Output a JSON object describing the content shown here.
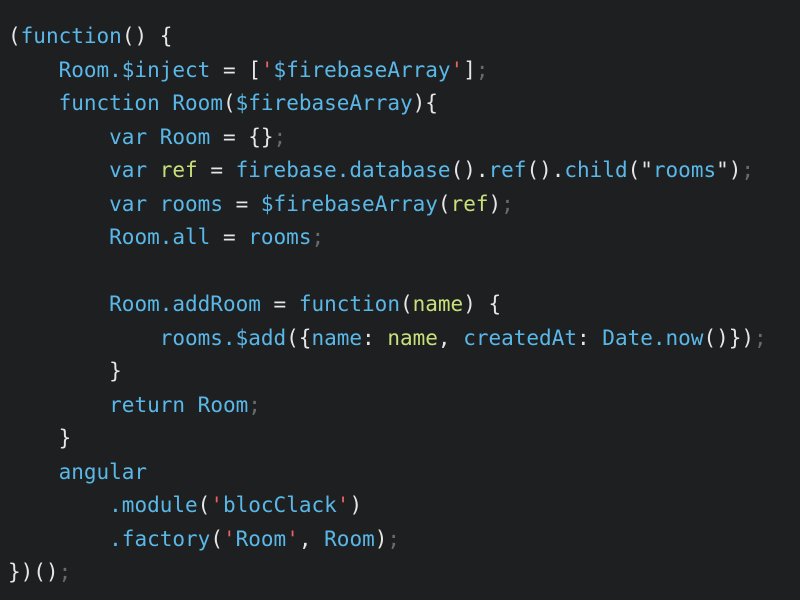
{
  "editor": {
    "lines": [
      [
        [
          "(",
          "default"
        ],
        [
          "function",
          "blue"
        ],
        [
          "() {",
          "default"
        ]
      ],
      [
        [
          "    ",
          "default"
        ],
        [
          "Room.$inject",
          "blue"
        ],
        [
          " = [",
          "default"
        ],
        [
          "'",
          "red"
        ],
        [
          "$firebaseArray",
          "blue"
        ],
        [
          "'",
          "red"
        ],
        [
          "]",
          "default"
        ],
        [
          ";",
          "dim"
        ]
      ],
      [
        [
          "    ",
          "default"
        ],
        [
          "function",
          "blue"
        ],
        [
          " ",
          "default"
        ],
        [
          "Room",
          "blue"
        ],
        [
          "(",
          "default"
        ],
        [
          "$firebaseArray",
          "blue"
        ],
        [
          "){",
          "default"
        ]
      ],
      [
        [
          "        ",
          "default"
        ],
        [
          "var",
          "blue"
        ],
        [
          " ",
          "default"
        ],
        [
          "Room",
          "blue"
        ],
        [
          " = {}",
          "default"
        ],
        [
          ";",
          "dim"
        ]
      ],
      [
        [
          "        ",
          "default"
        ],
        [
          "var",
          "blue"
        ],
        [
          " ",
          "default"
        ],
        [
          "ref",
          "green"
        ],
        [
          " = ",
          "default"
        ],
        [
          "firebase.database",
          "blue"
        ],
        [
          "().",
          "default"
        ],
        [
          "ref",
          "blue"
        ],
        [
          "().",
          "default"
        ],
        [
          "child",
          "blue"
        ],
        [
          "(\"",
          "default"
        ],
        [
          "rooms",
          "blue"
        ],
        [
          "\")",
          "default"
        ],
        [
          ";",
          "dim"
        ]
      ],
      [
        [
          "        ",
          "default"
        ],
        [
          "var",
          "blue"
        ],
        [
          " ",
          "default"
        ],
        [
          "rooms",
          "blue"
        ],
        [
          " = ",
          "default"
        ],
        [
          "$firebaseArray",
          "blue"
        ],
        [
          "(",
          "default"
        ],
        [
          "ref",
          "green"
        ],
        [
          ")",
          "default"
        ],
        [
          ";",
          "dim"
        ]
      ],
      [
        [
          "        ",
          "default"
        ],
        [
          "Room.all",
          "blue"
        ],
        [
          " = ",
          "default"
        ],
        [
          "rooms",
          "blue"
        ],
        [
          ";",
          "dim"
        ]
      ],
      [],
      [
        [
          "        ",
          "default"
        ],
        [
          "Room.addRoom",
          "blue"
        ],
        [
          " = ",
          "default"
        ],
        [
          "function",
          "blue"
        ],
        [
          "(",
          "default"
        ],
        [
          "name",
          "green"
        ],
        [
          ") {",
          "default"
        ]
      ],
      [
        [
          "            ",
          "default"
        ],
        [
          "rooms.$add",
          "blue"
        ],
        [
          "({",
          "default"
        ],
        [
          "name",
          "blue"
        ],
        [
          ": ",
          "default"
        ],
        [
          "name",
          "green"
        ],
        [
          ", ",
          "default"
        ],
        [
          "createdAt",
          "blue"
        ],
        [
          ": ",
          "default"
        ],
        [
          "Date.now",
          "blue"
        ],
        [
          "()})",
          "default"
        ],
        [
          ";",
          "dim"
        ]
      ],
      [
        [
          "        }",
          "default"
        ]
      ],
      [
        [
          "        ",
          "default"
        ],
        [
          "return",
          "blue"
        ],
        [
          " ",
          "default"
        ],
        [
          "Room",
          "blue"
        ],
        [
          ";",
          "dim"
        ]
      ],
      [
        [
          "    }",
          "default"
        ]
      ],
      [
        [
          "    ",
          "default"
        ],
        [
          "angular",
          "blue"
        ]
      ],
      [
        [
          "        ",
          "default"
        ],
        [
          ".module",
          "blue"
        ],
        [
          "(",
          "default"
        ],
        [
          "'",
          "red"
        ],
        [
          "blocClack",
          "blue"
        ],
        [
          "'",
          "red"
        ],
        [
          ")",
          "default"
        ]
      ],
      [
        [
          "        ",
          "default"
        ],
        [
          ".factory",
          "blue"
        ],
        [
          "(",
          "default"
        ],
        [
          "'",
          "red"
        ],
        [
          "Room",
          "blue"
        ],
        [
          "'",
          "red"
        ],
        [
          ", ",
          "default"
        ],
        [
          "Room",
          "blue"
        ],
        [
          ")",
          "default"
        ],
        [
          ";",
          "dim"
        ]
      ],
      [
        [
          "})()",
          "default"
        ],
        [
          ";",
          "dim"
        ]
      ]
    ]
  },
  "colors": {
    "background": "#1d1f21",
    "default": "#e6e6e6",
    "blue": "#5ab8e8",
    "green": "#c8e07a",
    "red": "#e8625f",
    "dim": "#676b6e"
  }
}
